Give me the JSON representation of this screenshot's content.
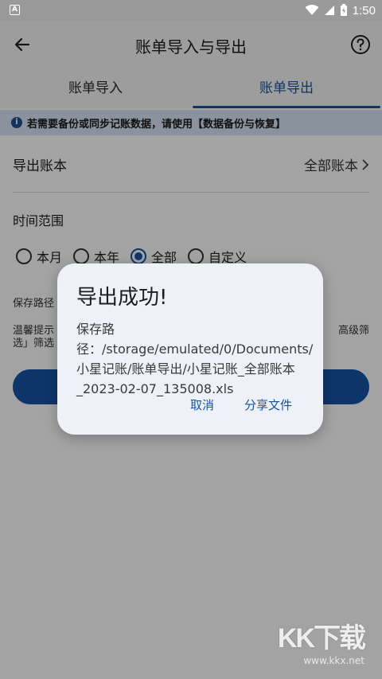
{
  "status_bar": {
    "time": "1:50",
    "app_icon": "A"
  },
  "header": {
    "title": "账单导入与导出"
  },
  "tabs": [
    {
      "label": "账单导入",
      "active": false
    },
    {
      "label": "账单导出",
      "active": true
    }
  ],
  "notice": {
    "text": "若需要备份或同步记账数据，请使用【数据备份与恢复】"
  },
  "export_book": {
    "label": "导出账本",
    "value": "全部账本"
  },
  "time_range": {
    "label": "时间范围",
    "options": [
      "本月",
      "本年",
      "全部",
      "自定义"
    ],
    "selected": "全部"
  },
  "background": {
    "save_path_label": "保存路径",
    "tip_line1_start": "温馨提示",
    "tip_line1_end": "高级筛",
    "tip_line2": "选」筛选"
  },
  "dialog": {
    "title": "导出成功!",
    "message": "保存路径：/storage/emulated/0/Documents/小星记账/账单导出/小星记账_全部账本_2023-02-07_135008.xls",
    "cancel_label": "取消",
    "share_label": "分享文件"
  },
  "watermark": {
    "logo": "KK下载",
    "url": "www.kkx.net"
  },
  "colors": {
    "accent": "#1553a4",
    "notice_bg": "#d8e4f6",
    "dialog_bg": "#eef2f8"
  }
}
